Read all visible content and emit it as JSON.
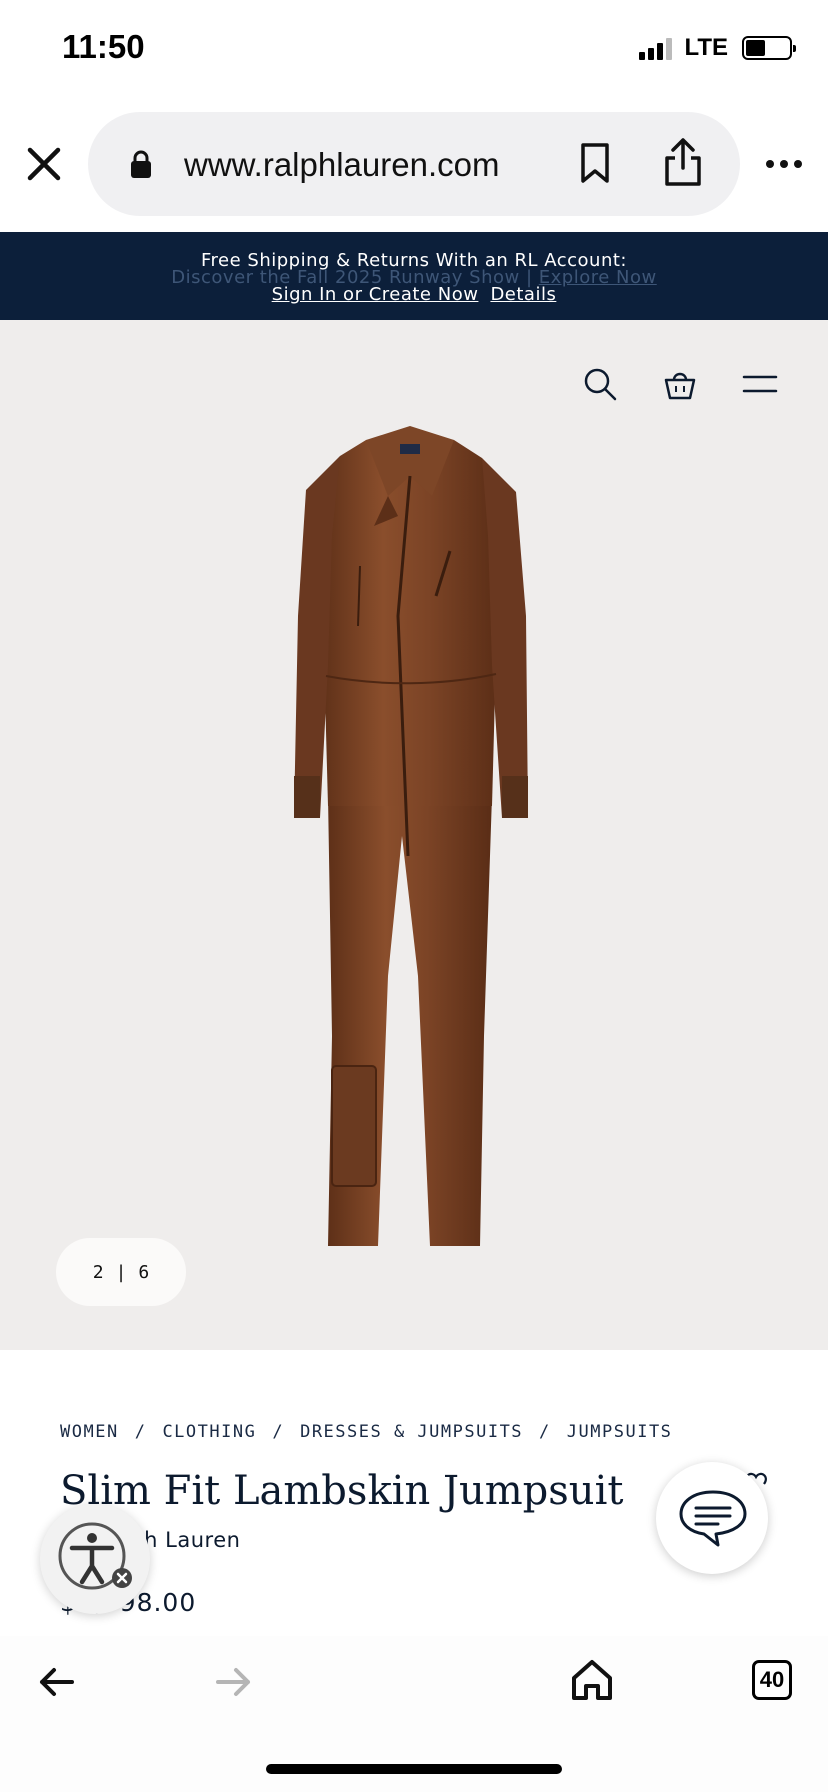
{
  "status": {
    "time": "11:50",
    "network": "LTE",
    "battery_level": 0.45
  },
  "browser": {
    "url": "www.ralphlauren.com",
    "icons": {
      "close": "close-icon",
      "lock": "lock-icon",
      "bookmark": "bookmark-icon",
      "share": "share-icon",
      "more": "more-icon"
    }
  },
  "promo": {
    "line1": "Free Shipping & Returns With an RL Account:",
    "ghost_text": "Discover the Fall 2025 Runway Show | ",
    "ghost_link": "Explore Now",
    "signin_link": "Sign In or Create Now",
    "details_link": "Details"
  },
  "hero": {
    "image_current": "2",
    "image_separator": "|",
    "image_total": "6",
    "icons": [
      "search-icon",
      "shopping-bag-icon",
      "menu-icon"
    ]
  },
  "product": {
    "breadcrumb": [
      "WOMEN",
      "CLOTHING",
      "DRESSES & JUMPSUITS",
      "JUMPSUITS"
    ],
    "breadcrumb_separator": "/",
    "title": "Slim Fit Lambskin Jumpsuit",
    "brand": "lph Lauren",
    "price": "$1,998.00"
  },
  "toolbar": {
    "tab_count": "40"
  },
  "colors": {
    "promo_bg": "#0c1f3a",
    "hero_bg": "#efedec",
    "text_navy": "#0c1a2e",
    "leather_brown": "#7a4426"
  }
}
